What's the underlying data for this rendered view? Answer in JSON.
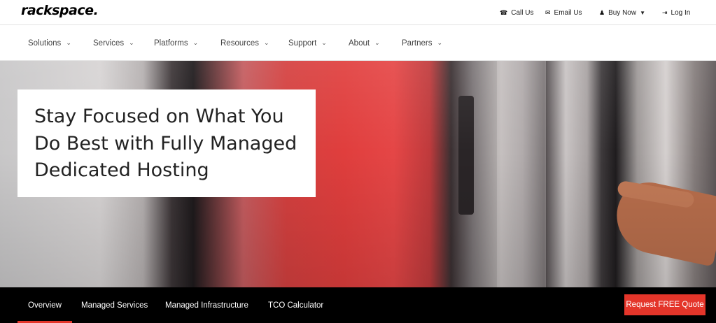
{
  "header": {
    "logo_text": "rackspace.",
    "utility_links": [
      {
        "icon": "phone-icon",
        "glyph": "☎",
        "label": "Call Us"
      },
      {
        "icon": "envelope-icon",
        "glyph": "✉",
        "label": "Email Us"
      },
      {
        "icon": "user-plus-icon",
        "glyph": "👤",
        "label": "Buy Now",
        "has_caret": true
      },
      {
        "icon": "sign-in-icon",
        "glyph": "➜",
        "label": "Log In"
      }
    ]
  },
  "nav": {
    "items": [
      "Solutions",
      "Services",
      "Platforms",
      "Resources",
      "Support",
      "About",
      "Partners"
    ]
  },
  "hero": {
    "title_line1": "Stay Focused on What You",
    "title_line2": "Do Best with Fully Managed",
    "title_line3": "Dedicated Hosting"
  },
  "subnav": {
    "items": [
      "Overview",
      "Managed Services",
      "Managed Infrastructure",
      "TCO Calculator"
    ],
    "active": "Overview",
    "cta_label": "Request FREE Quote"
  },
  "colors": {
    "accent": "#e4352a",
    "subnav_bg": "#000000"
  }
}
